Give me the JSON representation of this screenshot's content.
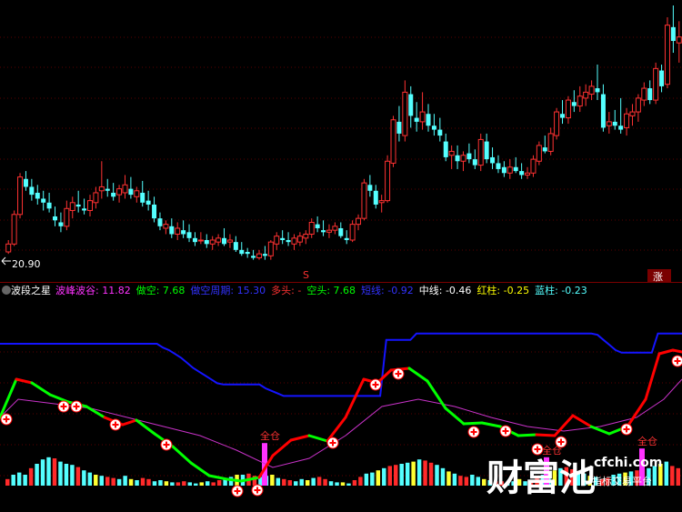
{
  "price_panel": {
    "low_price_label": "20.90",
    "signal_marker": "S",
    "up_badge": "涨",
    "colors": {
      "up": "#ff3232",
      "down": "#54ffff",
      "grid": "#7a0000"
    }
  },
  "indicator": {
    "name": "波段之星",
    "fields": [
      {
        "label": "波峰波谷:",
        "value": "11.82",
        "color": "#ff32ff"
      },
      {
        "label": "做空:",
        "value": "7.68",
        "color": "#00ff00"
      },
      {
        "label": "做空周期:",
        "value": "15.30",
        "color": "#3232ff"
      },
      {
        "label": "多头:",
        "value": "-",
        "color": "#ff3232"
      },
      {
        "label": "空头:",
        "value": "7.68",
        "color": "#00ff00"
      },
      {
        "label": "短线:",
        "value": "-0.92",
        "color": "#3232ff"
      },
      {
        "label": "中线:",
        "value": "-0.46",
        "color": "#ffffff"
      },
      {
        "label": "红柱:",
        "value": "-0.25",
        "color": "#ffff00"
      },
      {
        "label": "蓝柱:",
        "value": "-0.23",
        "color": "#54ffff"
      }
    ],
    "full_position_labels": [
      "全仓",
      "全仓",
      "全仓"
    ],
    "colors": {
      "bull_line": "#ff0000",
      "bear_line": "#00ff00",
      "upper_line": "#1414ff",
      "mid_line": "#c832c8",
      "bar_magenta": "#ff32ff"
    }
  },
  "watermark": {
    "brand": "财富池",
    "domain": "cfchi.com",
    "tagline": "指标交易平台"
  },
  "chart_data": {
    "type": "candlestick",
    "price_candles": [
      [
        20.9,
        21.5,
        20.8,
        21.3
      ],
      [
        21.3,
        23.0,
        21.2,
        22.8
      ],
      [
        22.8,
        24.9,
        22.6,
        24.7
      ],
      [
        24.6,
        25.0,
        24.0,
        24.2
      ],
      [
        24.2,
        24.6,
        23.5,
        23.8
      ],
      [
        23.9,
        24.3,
        23.3,
        23.6
      ],
      [
        23.6,
        24.0,
        23.0,
        23.4
      ],
      [
        23.4,
        23.9,
        22.9,
        23.1
      ],
      [
        22.7,
        23.2,
        22.2,
        22.5
      ],
      [
        22.4,
        22.9,
        21.9,
        22.2
      ],
      [
        22.2,
        23.5,
        22.0,
        23.1
      ],
      [
        23.0,
        23.7,
        22.6,
        23.4
      ],
      [
        23.3,
        24.0,
        22.9,
        23.2
      ],
      [
        23.1,
        23.6,
        22.8,
        23.0
      ],
      [
        23.0,
        23.8,
        22.7,
        23.5
      ],
      [
        23.4,
        24.2,
        23.1,
        23.9
      ],
      [
        24.0,
        25.5,
        23.6,
        24.2
      ],
      [
        24.1,
        24.6,
        23.7,
        24.0
      ],
      [
        23.9,
        24.4,
        23.5,
        23.7
      ],
      [
        23.8,
        24.3,
        23.4,
        24.1
      ],
      [
        23.9,
        24.8,
        23.6,
        24.3
      ],
      [
        24.1,
        24.7,
        23.6,
        23.8
      ],
      [
        23.7,
        24.2,
        23.4,
        24.0
      ],
      [
        23.9,
        24.5,
        23.2,
        23.4
      ],
      [
        23.5,
        24.0,
        23.0,
        23.3
      ],
      [
        23.3,
        23.7,
        22.4,
        22.6
      ],
      [
        22.6,
        22.9,
        22.0,
        22.2
      ],
      [
        22.1,
        22.5,
        21.8,
        22.3
      ],
      [
        22.2,
        22.6,
        21.6,
        21.8
      ],
      [
        21.8,
        22.4,
        21.5,
        22.1
      ],
      [
        22.0,
        22.5,
        21.6,
        21.8
      ],
      [
        21.9,
        22.3,
        21.4,
        21.6
      ],
      [
        21.6,
        21.9,
        21.2,
        21.4
      ],
      [
        21.5,
        21.9,
        21.3,
        21.5
      ],
      [
        21.5,
        21.8,
        21.1,
        21.3
      ],
      [
        21.3,
        21.7,
        21.0,
        21.5
      ],
      [
        21.4,
        21.8,
        21.2,
        21.6
      ],
      [
        21.6,
        22.1,
        21.2,
        21.3
      ],
      [
        21.4,
        21.8,
        21.1,
        21.5
      ],
      [
        21.4,
        21.7,
        20.9,
        21.0
      ],
      [
        21.0,
        21.4,
        20.7,
        20.8
      ],
      [
        20.9,
        21.1,
        20.6,
        20.8
      ],
      [
        20.7,
        21.0,
        20.5,
        20.6
      ],
      [
        20.6,
        21.0,
        20.5,
        20.8
      ],
      [
        20.8,
        21.2,
        20.5,
        20.7
      ],
      [
        20.7,
        21.5,
        20.5,
        21.4
      ],
      [
        21.3,
        21.9,
        21.0,
        21.7
      ],
      [
        21.6,
        22.0,
        21.3,
        21.5
      ],
      [
        21.5,
        21.9,
        21.2,
        21.4
      ],
      [
        21.3,
        21.8,
        21.0,
        21.6
      ],
      [
        21.4,
        21.9,
        21.2,
        21.7
      ],
      [
        21.6,
        22.0,
        21.3,
        21.8
      ],
      [
        21.8,
        22.6,
        21.6,
        22.4
      ],
      [
        22.3,
        22.7,
        21.9,
        22.1
      ],
      [
        22.0,
        22.5,
        21.7,
        21.9
      ],
      [
        21.9,
        22.3,
        21.6,
        22.0
      ],
      [
        22.0,
        22.4,
        21.8,
        22.2
      ],
      [
        22.1,
        22.4,
        21.6,
        21.7
      ],
      [
        21.6,
        22.0,
        21.3,
        21.5
      ],
      [
        21.5,
        22.5,
        21.4,
        22.3
      ],
      [
        22.3,
        22.8,
        22.0,
        22.6
      ],
      [
        22.6,
        24.6,
        22.5,
        24.4
      ],
      [
        24.3,
        24.8,
        23.7,
        24.0
      ],
      [
        24.0,
        24.3,
        23.1,
        23.3
      ],
      [
        23.4,
        23.8,
        22.9,
        23.5
      ],
      [
        23.5,
        25.8,
        23.4,
        25.5
      ],
      [
        25.4,
        27.8,
        25.2,
        27.6
      ],
      [
        27.5,
        28.3,
        26.5,
        26.9
      ],
      [
        26.8,
        29.6,
        26.5,
        29.0
      ],
      [
        28.9,
        29.3,
        27.2,
        27.8
      ],
      [
        27.7,
        28.5,
        27.0,
        27.5
      ],
      [
        27.5,
        29.0,
        27.1,
        28.0
      ],
      [
        27.9,
        28.4,
        27.0,
        27.3
      ],
      [
        27.3,
        27.9,
        26.8,
        27.1
      ],
      [
        27.1,
        27.7,
        26.5,
        26.8
      ],
      [
        26.5,
        26.9,
        25.5,
        25.7
      ],
      [
        25.8,
        26.3,
        25.1,
        26.0
      ],
      [
        25.8,
        26.3,
        25.1,
        25.5
      ],
      [
        25.5,
        26.0,
        25.0,
        25.8
      ],
      [
        25.9,
        26.4,
        25.4,
        25.6
      ],
      [
        25.6,
        26.1,
        25.1,
        25.3
      ],
      [
        25.3,
        26.9,
        25.0,
        26.6
      ],
      [
        26.5,
        26.9,
        25.4,
        25.6
      ],
      [
        25.7,
        26.2,
        25.1,
        25.4
      ],
      [
        25.4,
        25.8,
        24.9,
        25.1
      ],
      [
        25.2,
        25.5,
        24.7,
        24.9
      ],
      [
        24.9,
        25.6,
        24.6,
        25.2
      ],
      [
        25.2,
        25.7,
        24.9,
        25.0
      ],
      [
        25.0,
        25.4,
        24.6,
        24.8
      ],
      [
        24.8,
        25.2,
        24.6,
        24.9
      ],
      [
        24.9,
        25.8,
        24.7,
        25.6
      ],
      [
        25.5,
        26.5,
        25.3,
        26.3
      ],
      [
        26.2,
        26.8,
        25.9,
        26.0
      ],
      [
        26.0,
        27.2,
        25.8,
        26.9
      ],
      [
        26.8,
        28.2,
        26.6,
        28.0
      ],
      [
        27.9,
        28.6,
        27.4,
        27.7
      ],
      [
        27.7,
        28.8,
        27.4,
        28.6
      ],
      [
        28.5,
        29.1,
        28.0,
        28.3
      ],
      [
        28.3,
        29.3,
        28.0,
        28.8
      ],
      [
        28.7,
        29.4,
        28.3,
        29.0
      ],
      [
        28.9,
        29.6,
        28.6,
        29.3
      ],
      [
        29.2,
        30.4,
        28.6,
        29.0
      ],
      [
        28.9,
        29.4,
        27.0,
        27.2
      ],
      [
        27.3,
        28.0,
        26.9,
        27.5
      ],
      [
        27.5,
        28.1,
        27.1,
        27.3
      ],
      [
        27.3,
        28.7,
        26.9,
        27.1
      ],
      [
        27.2,
        28.2,
        26.8,
        27.9
      ],
      [
        27.8,
        28.4,
        27.3,
        28.0
      ],
      [
        28.0,
        28.9,
        27.5,
        28.7
      ],
      [
        28.6,
        29.5,
        28.3,
        29.2
      ],
      [
        29.2,
        29.6,
        28.4,
        28.6
      ],
      [
        28.6,
        30.5,
        28.4,
        30.2
      ],
      [
        30.1,
        30.4,
        29.0,
        29.3
      ],
      [
        29.4,
        32.8,
        29.2,
        32.4
      ],
      [
        32.3,
        33.4,
        31.0,
        31.6
      ],
      [
        31.5,
        32.6,
        30.5,
        31.8
      ]
    ],
    "osc_bars": [
      0.6,
      1.0,
      1.2,
      1.0,
      1.6,
      2.0,
      2.4,
      2.6,
      2.5,
      2.2,
      2.0,
      1.9,
      1.7,
      1.4,
      1.2,
      1.0,
      0.9,
      0.8,
      0.7,
      0.6,
      0.9,
      0.6,
      0.5,
      0.7,
      0.6,
      0.4,
      0.5,
      0.4,
      0.3,
      0.3,
      0.4,
      0.3,
      0.2,
      0.3,
      0.4,
      0.3,
      0.5,
      0.6,
      0.8,
      1.0,
      1.0,
      1.1,
      0.9,
      0.8,
      0.9,
      1.0,
      0.7,
      0.6,
      0.5,
      0.4,
      0.6,
      0.5,
      0.7,
      0.8,
      0.6,
      0.4,
      0.3,
      0.3,
      0.2,
      0.5,
      0.8,
      1.1,
      1.2,
      1.4,
      1.6,
      1.8,
      1.9,
      2.0,
      2.1,
      2.2,
      2.4,
      2.3,
      2.1,
      1.9,
      1.6,
      1.3,
      1.1,
      0.9,
      0.8,
      1.0,
      0.8,
      0.6,
      0.5,
      0.4,
      0.4,
      0.3,
      0.4,
      0.6,
      0.4,
      0.5,
      0.8,
      1.0,
      1.2,
      1.4,
      1.6,
      1.7,
      1.5,
      1.3,
      1.1,
      0.9,
      0.8,
      0.6,
      0.7,
      1.0,
      1.1,
      1.2,
      1.3,
      1.4,
      1.5,
      1.6,
      1.8,
      2.0,
      2.2,
      1.8,
      1.6
    ],
    "magenta_bars": [
      {
        "i": 47,
        "h": 3.9
      },
      {
        "i": 98,
        "h": 2.6
      },
      {
        "i": 114,
        "h": 3.4
      }
    ],
    "bull_line_segments": [
      [
        0,
        1
      ],
      [
        2,
        6
      ],
      [
        27,
        32
      ],
      [
        63,
        70
      ],
      [
        85,
        90
      ],
      [
        102,
        104
      ],
      [
        108,
        121
      ],
      [
        146,
        150
      ]
    ],
    "upper_band": [
      11.5,
      11.5,
      11.5,
      11.5,
      11.5,
      11.5,
      11.5,
      11.5,
      11.5,
      11.5,
      11.5,
      11.5,
      11.5,
      11.5,
      11.5,
      11.5,
      11.5,
      11.5,
      11.5,
      11.5,
      11.5,
      11.5,
      11.5,
      11.5,
      11.5,
      11.5,
      11.5,
      11.2,
      11.0,
      10.7,
      10.4,
      10.0,
      9.6,
      9.3,
      9.0,
      8.7,
      8.4,
      8.3,
      8.3,
      8.3,
      8.3,
      8.3,
      8.3,
      8.3,
      8.0,
      7.8,
      7.6,
      7.4,
      7.4,
      7.4,
      7.4,
      7.4,
      7.4,
      7.4,
      7.4,
      7.4,
      7.4,
      7.4,
      7.4,
      7.4,
      7.4,
      7.4,
      7.4,
      7.4,
      11.8,
      11.8,
      11.8,
      11.8,
      11.8,
      12.3,
      12.3,
      12.3,
      12.3,
      12.3,
      12.3,
      12.3,
      12.3,
      12.3,
      12.3,
      12.3,
      12.3,
      12.3,
      12.3,
      12.3,
      12.3,
      12.3,
      12.3,
      12.3,
      12.3,
      12.3,
      12.3,
      12.3,
      12.3,
      12.3,
      12.3,
      12.3,
      12.3,
      12.3,
      12.3,
      12.2,
      11.8,
      11.4,
      11.0,
      10.8,
      10.8,
      10.8,
      10.8,
      10.8,
      10.8,
      12.3,
      12.3,
      12.3,
      12.3,
      12.3
    ]
  }
}
